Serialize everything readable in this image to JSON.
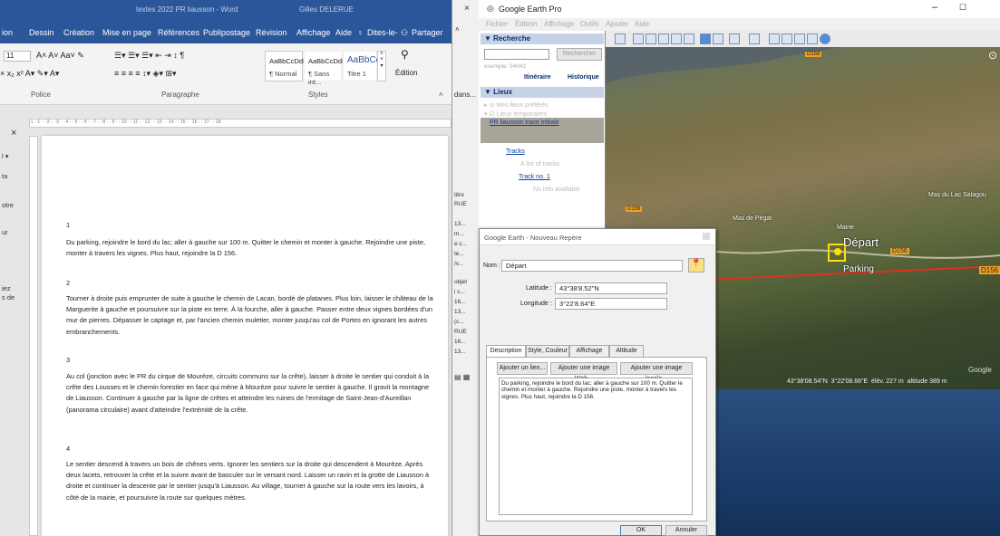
{
  "word": {
    "title": "textes 2022 PR liausson - Word",
    "user": "Gilles DELERUE",
    "menu": [
      "ion",
      "Dessin",
      "Création",
      "Mise en page",
      "Références",
      "Publipostage",
      "Révision",
      "Affichage",
      "Aide",
      "Dites-le-",
      "Partager"
    ],
    "ribbon": {
      "font_size": "11",
      "groups": [
        "Police",
        "Paragraphe",
        "Styles"
      ],
      "styles": [
        {
          "preview": "AaBbCcDdE",
          "name": "¶ Normal"
        },
        {
          "preview": "AaBbCcDdE",
          "name": "¶ Sans int..."
        },
        {
          "preview": "AaBbCcI",
          "name": "Titre 1"
        }
      ],
      "edit_label": "Édition"
    },
    "sidebar_texts": [
      "ta",
      "otre",
      "ur",
      "iez",
      "s de"
    ],
    "paragraphs": [
      {
        "num": "1",
        "text": "Du parking, rejoindre le bord du lac; aller à gauche sur 100 m. Quitter le chemin et monter à gauche. Rejoindre une piste, monter à travers les vignes. Plus haut, rejoindre la D 156."
      },
      {
        "num": "2",
        "text": "Tourner à droite puis emprunter de suite à gauche le chemin de Lacan, bordé de platanes. Plus loin, laisser le château de la Marguerite à gauche et poursuivre sur la piste en terre. À la fourche, aller à gauche. Passer entre deux vignes bordées d'un mur de pierres. Dépasser le captage et, par l'ancien chemin muletier, monter jusqu'au col de Portes en ignorant les autres embranchements."
      },
      {
        "num": "3",
        "text": "Au col (jonction avec le PR du cirque de Mourèze, circuits communs sur la crête), laisser à droite le sentier qui conduit à la crête des Lousses et le chemin forestier en face qui mène à Mourèze pour suivre le sentier à gauche. Il gravit la montagne de Liausson. Continuer à gauche par la ligne de crêtes et atteindre les ruines de l'ermitage de Saint-Jean-d'Aureillan (panorama circulaire) avant d'atteindre l'extrémité de la crête."
      },
      {
        "num": "4",
        "text": "Le sentier descend à travers un bois de chênes verts. Ignorer les sentiers sur la droite qui descendent à Mourèze. Après deux lacets, retrouver la crête et la suivre avant de basculer sur le versant nord. Laisser un ravin et la grotte de Liausson à droite et continuer la descente par le sentier jusqu'à Liausson. Au village, tourner à gauche sur la route vers les lavoirs, à côté de la mairie, et poursuivre la route sur quelques mètres."
      }
    ]
  },
  "middle": {
    "search": "dans...",
    "items": [
      "titre",
      "RUE",
      "13...",
      "m...",
      "e c...",
      "te...",
      "/v...",
      "objet",
      "i c...",
      "16...",
      "13...",
      "(c...",
      "RUE",
      "16...",
      "13..."
    ]
  },
  "earth": {
    "title": "Google Earth Pro",
    "menu": [
      "Fichier",
      "Édition",
      "Affichage",
      "Outils",
      "Ajouter",
      "Aide"
    ],
    "search_header": "Recherche",
    "search_button": "Rechercher",
    "search_hint": "exemple: 94043",
    "search_links": [
      "Itinéraire",
      "Historique"
    ],
    "places_header": "Lieux",
    "places": [
      {
        "label": "Mes lieux préférés"
      },
      {
        "label": "Lieux temporaires"
      },
      {
        "label": "PR liausson trace initiale"
      },
      {
        "label": "Tracks"
      },
      {
        "label": "A list of tracks"
      },
      {
        "label": "Track no. 1"
      },
      {
        "label": "No info available"
      }
    ],
    "map_labels": {
      "depart": "Départ",
      "parking": "Parking",
      "mairie": "Mairie",
      "mas_de_pegat": "Mas de Pégat",
      "lac": "Mas du Lac Salagou",
      "d156a": "D156",
      "d156b": "D156",
      "d156c": "D156",
      "d156d": "D156"
    },
    "status": {
      "lat": "43°38'08.54\"N",
      "lon": "3°22'08.66\"E",
      "elev_label": "élév.",
      "elev": "227 m",
      "alt_label": "altitude",
      "alt": "389 m",
      "brand": "Google"
    },
    "colors": {
      "track": "#e03020",
      "placemark": "#ffe000"
    }
  },
  "dialog": {
    "title": "Google Earth - Nouveau Repère",
    "name_label": "Nom :",
    "name_value": "Départ",
    "lat_label": "Latitude :",
    "lat_value": "43°38'8.52\"N",
    "lon_label": "Longitude :",
    "lon_value": "3°22'8.64\"E",
    "tabs": [
      "Description",
      "Style, Couleur",
      "Affichage",
      "Altitude"
    ],
    "buttons": [
      "Ajouter un lien...",
      "Ajouter une image Web...",
      "Ajouter une image locale..."
    ],
    "description": "Du parking, rejoindre le bord du lac; aller à gauche sur 100 m. Quitter le chemin et monter à gauche. Rejoindre une piste, monter à travers les vignes. Plus haut, rejoindre la D 156.",
    "ok": "OK",
    "cancel": "Annuler"
  }
}
